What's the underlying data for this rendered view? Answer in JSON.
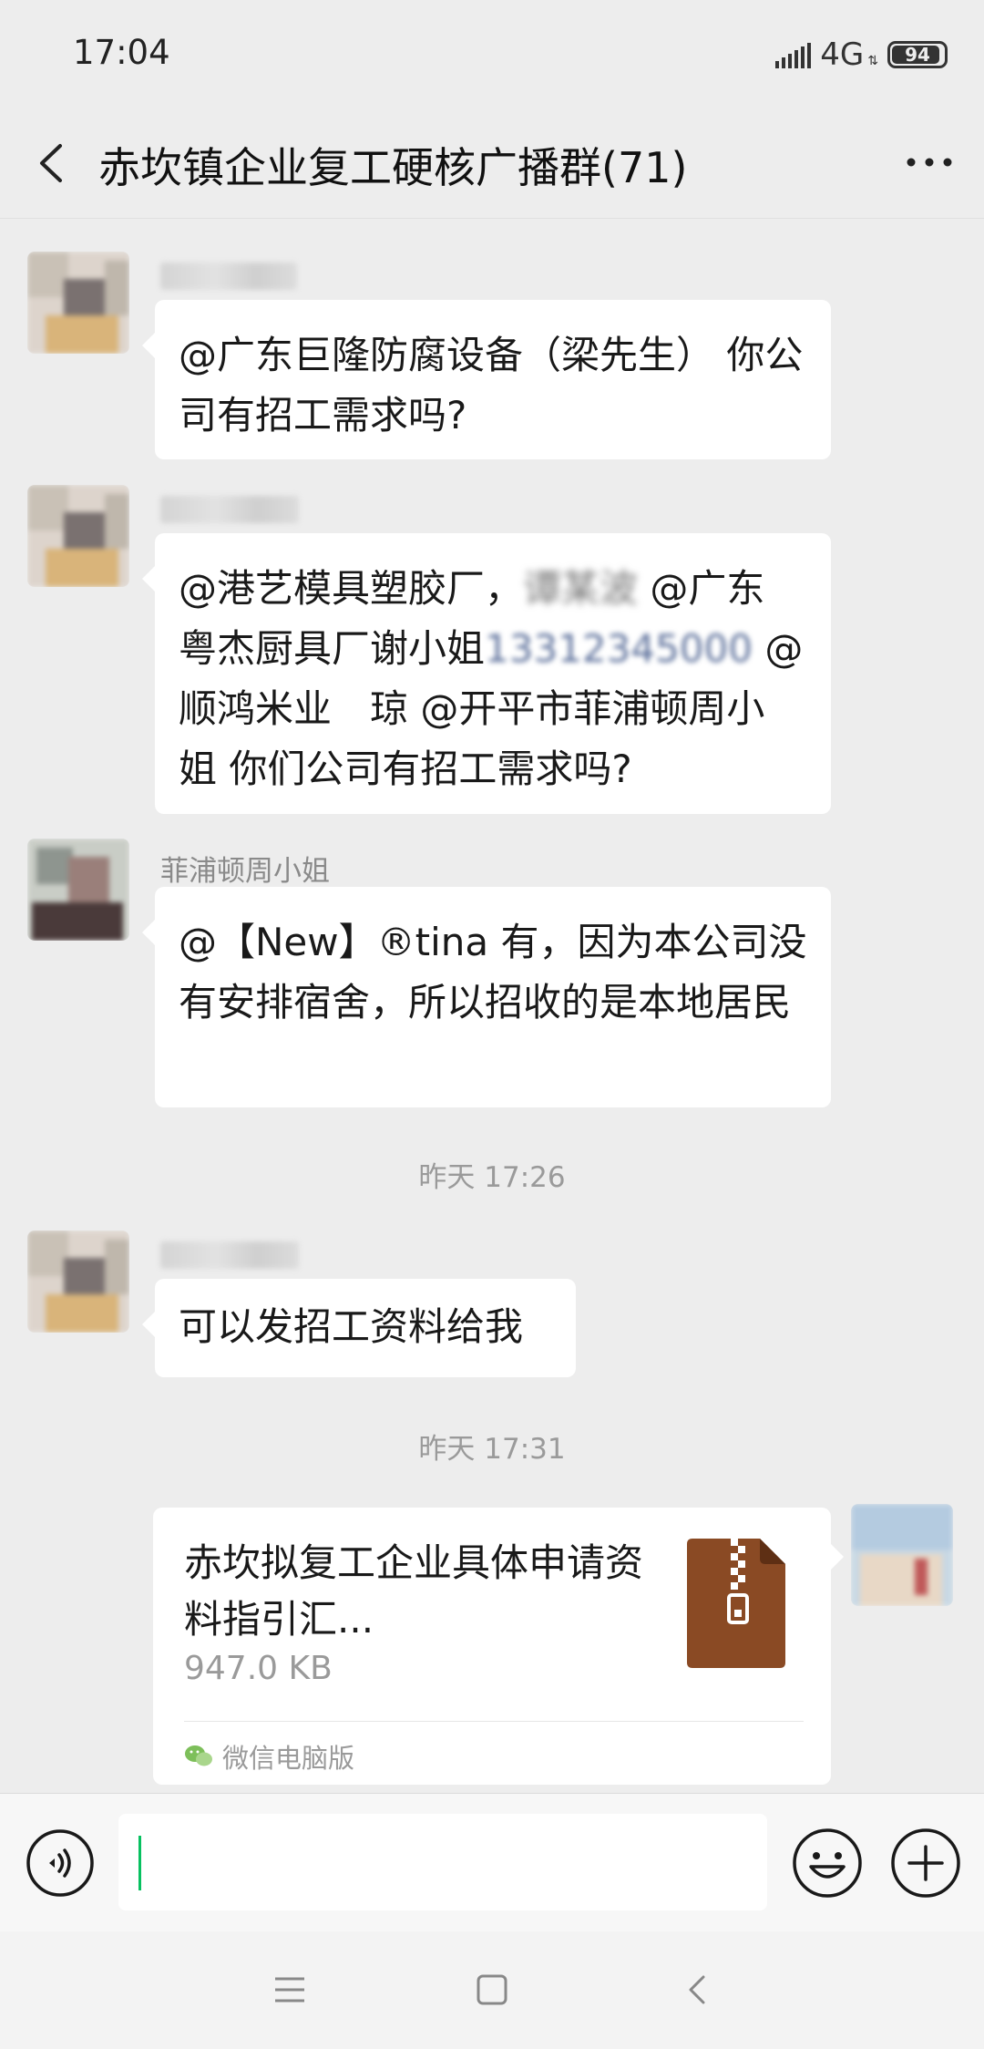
{
  "status_bar": {
    "time": "17:04",
    "network": "4G",
    "battery": "94",
    "battery_level_percent": 94
  },
  "header": {
    "title": "赤坎镇企业复工硬核广播群(71)",
    "back_icon": "chevron-left-icon",
    "more_icon": "more-dots-icon"
  },
  "messages": [
    {
      "sender": "",
      "text": "@广东巨隆防腐设备（梁先生） 你公司有招工需求吗?"
    },
    {
      "sender": "",
      "line1_a": "@港艺模具塑胶厂，",
      "line1_blur": "谭某波",
      "line1_b": " @广东",
      "line2_a": "粤杰厨具厂谢小姐",
      "line2_link": "13312345000",
      "line2_b": " @",
      "line3": "顺鸿米业　琼 @开平市菲浦顿周小",
      "line4": "姐  你们公司有招工需求吗?"
    },
    {
      "sender": "菲浦顿周小姐",
      "text": "@【New】®tina 有，因为本公司没有安排宿舍，所以招收的是本地居民"
    },
    {
      "sender": "",
      "text": "可以发招工资料给我"
    }
  ],
  "timestamps": [
    "昨天 17:26",
    "昨天 17:31"
  ],
  "file_message": {
    "name": "赤坎拟复工企业具体申请资料指引汇...",
    "size": "947.0 KB",
    "source": "微信电脑版",
    "file_icon": "zip-file-icon",
    "source_icon": "wechat-icon",
    "icon_color": "#8a4a24"
  },
  "input_bar": {
    "value": "",
    "voice_icon": "voice-icon",
    "emoji_icon": "emoji-icon",
    "plus_icon": "plus-icon"
  },
  "nav_bar": {
    "menu_icon": "menu-icon",
    "home_icon": "home-icon",
    "back_icon": "back-icon"
  },
  "colors": {
    "background": "#ededed",
    "bubble": "#ffffff",
    "caret": "#07c160",
    "link": "#5b6f9a"
  }
}
